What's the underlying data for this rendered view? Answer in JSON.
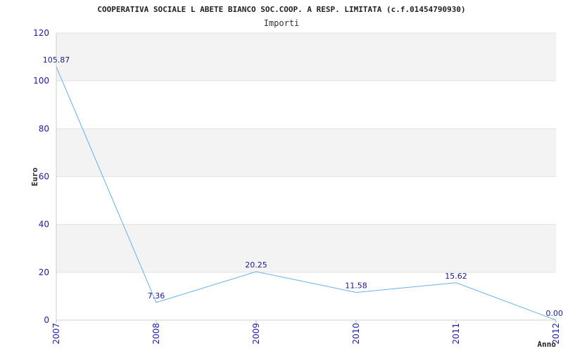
{
  "chart_data": {
    "type": "line",
    "title": "COOPERATIVA SOCIALE L ABETE BIANCO SOC.COOP. A RESP. LIMITATA (c.f.01454790930)",
    "subtitle": "Importi",
    "xlabel": "Anno",
    "ylabel": "Euro",
    "categories": [
      "2007",
      "2008",
      "2009",
      "2010",
      "2011",
      "2012"
    ],
    "series": [
      {
        "values": [
          105.87,
          7.36,
          20.25,
          11.58,
          15.62,
          0.0
        ],
        "labels": [
          "105.87",
          "7.36",
          "20.25",
          "11.58",
          "15.62",
          "0.00"
        ]
      }
    ],
    "ylim": [
      0,
      120
    ],
    "yticks": [
      "0",
      "20",
      "40",
      "60",
      "80",
      "100",
      "120"
    ],
    "grid": true,
    "band_color": "#f3f3f3",
    "line_color": "#6aaee8"
  }
}
